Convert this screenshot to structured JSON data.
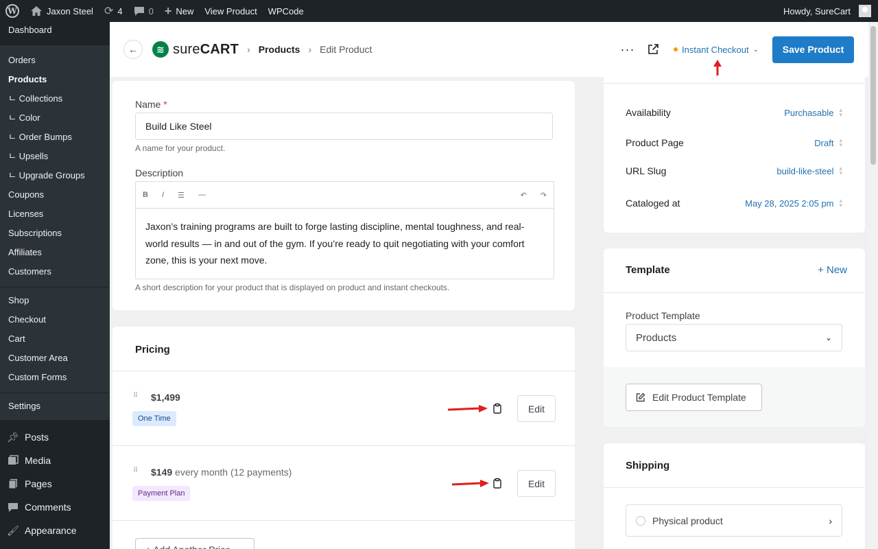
{
  "adminbar": {
    "site_name": "Jaxon Steel",
    "updates_count": "4",
    "comments_count": "0",
    "new_label": "New",
    "view_product": "View Product",
    "wpcode": "WPCode",
    "howdy": "Howdy, SureCart"
  },
  "sidebar": {
    "dashboard": "Dashboard",
    "surecart_items": [
      "Orders",
      "Products",
      "ㄴ Collections",
      "ㄴ Color",
      "ㄴ Order Bumps",
      "ㄴ Upsells",
      "ㄴ Upgrade Groups",
      "Coupons",
      "Licenses",
      "Subscriptions",
      "Affiliates",
      "Customers"
    ],
    "shop_items": [
      "Shop",
      "Checkout",
      "Cart",
      "Customer Area",
      "Custom Forms"
    ],
    "settings": "Settings",
    "wp_items": [
      "Posts",
      "Media",
      "Pages",
      "Comments",
      "Appearance"
    ]
  },
  "header": {
    "logo_part1": "sure",
    "logo_part2": "CART",
    "breadcrumb_1": "Products",
    "breadcrumb_2": "Edit Product",
    "dots": "···",
    "checkout_label": "Instant Checkout",
    "save_label": "Save Product"
  },
  "product": {
    "name_label": "Name",
    "name_required": "*",
    "name_value": "Build Like Steel",
    "name_help": "A name for your product.",
    "description_label": "Description",
    "description_value": "Jaxon’s training programs are built to forge lasting discipline, mental toughness, and real-world results — in and out of the gym. If you’re ready to quit negotiating with your comfort zone, this is your next move.",
    "description_help": "A short description for your product that is displayed on product and instant checkouts.",
    "toolbar": {
      "bold": "B",
      "italic": "I",
      "list": "☰",
      "hr": "—",
      "undo": "↶",
      "redo": "↷"
    }
  },
  "pricing": {
    "title": "Pricing",
    "prices": [
      {
        "amount": "$1,499",
        "rest": "",
        "badge": "One Time",
        "edit_label": "Edit"
      },
      {
        "amount": "$149",
        "rest": " every month (12 payments)",
        "badge": "Payment Plan",
        "edit_label": "Edit"
      }
    ],
    "add_another_label": "+ Add Another Price"
  },
  "status": {
    "rows": [
      {
        "label": "Availability",
        "value": "Purchasable"
      },
      {
        "label": "Product Page",
        "value": "Draft"
      },
      {
        "label": "URL Slug",
        "value": "build-like-steel"
      },
      {
        "label": "Cataloged at",
        "value": "May 28, 2025 2:05 pm"
      }
    ]
  },
  "template": {
    "title": "Template",
    "new_label": "+ New",
    "field_label": "Product Template",
    "selected": "Products",
    "edit_button": "Edit Product Template"
  },
  "shipping": {
    "title": "Shipping",
    "option": "Physical product"
  },
  "colors": {
    "adminbar_bg": "#1d2327",
    "accent_blue": "#2271b1",
    "save_button": "#1e7cc8",
    "annotation_arrow": "#e11d1d",
    "brand_green": "#01824c"
  }
}
